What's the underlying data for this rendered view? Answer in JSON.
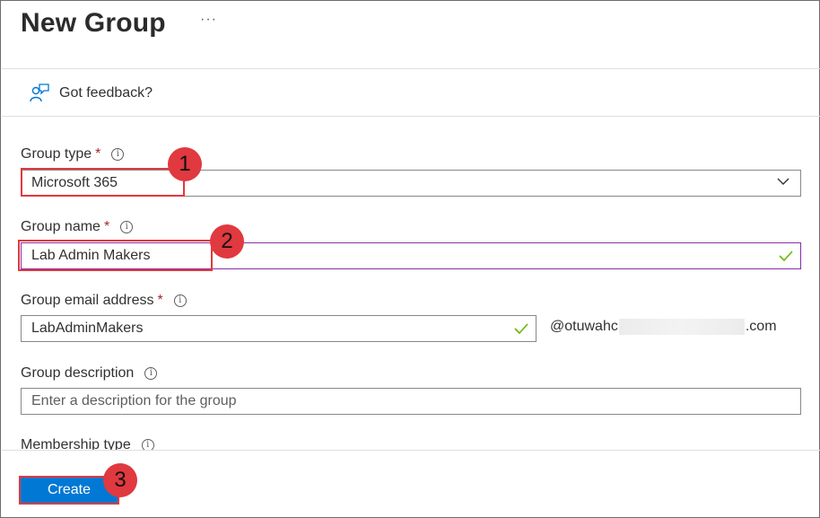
{
  "header": {
    "title": "New Group",
    "more_label": "···"
  },
  "feedback": {
    "label": "Got feedback?"
  },
  "form": {
    "group_type": {
      "label": "Group type",
      "required_mark": "*",
      "value": "Microsoft 365"
    },
    "group_name": {
      "label": "Group name",
      "required_mark": "*",
      "value": "Lab Admin Makers"
    },
    "group_email": {
      "label": "Group email address",
      "required_mark": "*",
      "value": "LabAdminMakers",
      "suffix_start": "@otuwahc",
      "suffix_end": ".com"
    },
    "group_description": {
      "label": "Group description",
      "placeholder": "Enter a description for the group"
    },
    "membership_type": {
      "label": "Membership type"
    }
  },
  "footer": {
    "create_label": "Create"
  },
  "annotations": {
    "step1": "1",
    "step2": "2",
    "step3": "3",
    "highlight_color": "#e0393f"
  },
  "colors": {
    "accent": "#0078d4",
    "valid_check": "#6bb700",
    "focus_border": "#8a2da5",
    "required": "#a4262c"
  }
}
